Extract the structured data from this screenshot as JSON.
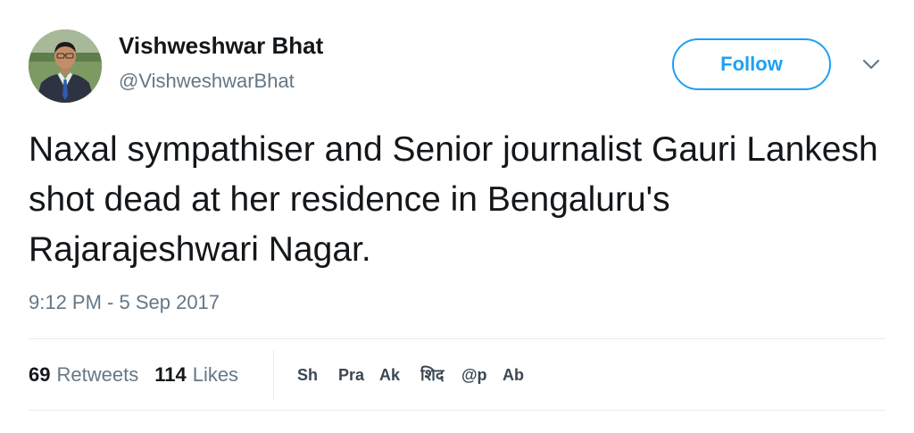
{
  "author": {
    "display_name": "Vishweshwar Bhat",
    "handle": "@VishweshwarBhat"
  },
  "follow_button": {
    "label": "Follow"
  },
  "tweet": {
    "text": "Naxal sympathiser and Senior journalist Gauri Lankesh shot dead at her residence in Bengaluru's Rajarajeshwari Nagar.",
    "timestamp": "9:12 PM - 5 Sep 2017"
  },
  "stats": {
    "retweets": {
      "count": "69",
      "label": "Retweets"
    },
    "likes": {
      "count": "114",
      "label": "Likes"
    }
  },
  "likers": [
    {
      "label": "Sh"
    },
    {
      "label": "Pra"
    },
    {
      "label": "Ak"
    },
    {
      "label": "शिद"
    },
    {
      "label": "@p"
    },
    {
      "label": "Ab"
    }
  ],
  "icons": {
    "avatar": "profile-photo",
    "caret": "chevron-down-icon"
  },
  "colors": {
    "accent": "#1da1f2",
    "text_primary": "#14171a",
    "text_secondary": "#657786",
    "divider": "#e6ecf0"
  }
}
